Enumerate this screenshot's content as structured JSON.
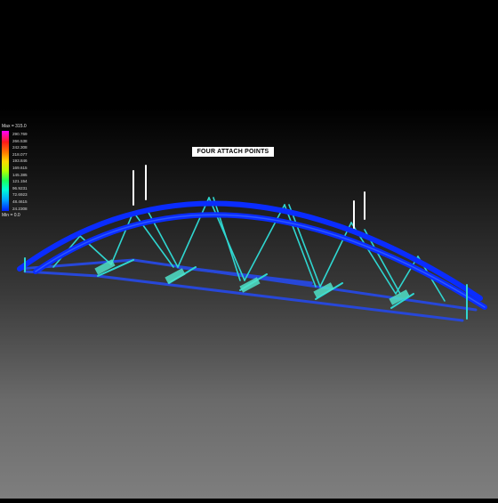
{
  "legend": {
    "max_label": "Max = 315.0",
    "min_label": "Min = 0.0",
    "ticks": [
      "290.769",
      "266.538",
      "242.308",
      "218.077",
      "193.846",
      "169.615",
      "145.385",
      "121.154",
      "96.9231",
      "72.6923",
      "48.4615",
      "24.2308"
    ]
  },
  "callout": {
    "text": "FOUR ATTACH POINTS"
  },
  "colors": {
    "arch": "#0a2cff",
    "arch_highlight": "#3b6bff",
    "web": "#2fd6d0",
    "bottom_chord": "#2747d8",
    "load_marker": "#ffffff"
  }
}
